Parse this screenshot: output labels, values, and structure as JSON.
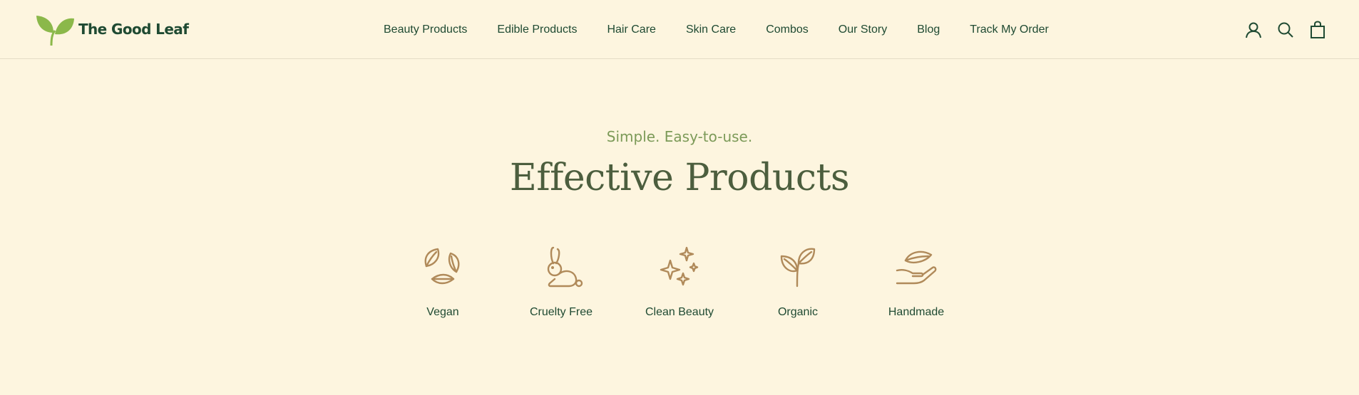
{
  "brand": {
    "name": "The Good Leaf"
  },
  "nav": {
    "items": [
      {
        "label": "Beauty Products"
      },
      {
        "label": "Edible Products"
      },
      {
        "label": "Hair Care"
      },
      {
        "label": "Skin Care"
      },
      {
        "label": "Combos"
      },
      {
        "label": "Our Story"
      },
      {
        "label": "Blog"
      },
      {
        "label": "Track My Order"
      }
    ]
  },
  "header_icons": [
    "account-icon",
    "search-icon",
    "cart-icon"
  ],
  "hero": {
    "eyebrow": "Simple. Easy-to-use.",
    "title": "Effective Products"
  },
  "features": [
    {
      "label": "Vegan",
      "icon": "leaves-icon"
    },
    {
      "label": "Cruelty Free",
      "icon": "rabbit-icon"
    },
    {
      "label": "Clean Beauty",
      "icon": "sparkles-icon"
    },
    {
      "label": "Organic",
      "icon": "sprout-icon"
    },
    {
      "label": "Handmade",
      "icon": "hand-leaf-icon"
    }
  ],
  "colors": {
    "background": "#fdf5df",
    "text": "#1f4a32",
    "accent_green": "#7c9a58",
    "headline": "#4c5e3e",
    "icon_tan": "#b08a5a",
    "logo_leaf": "#8bb84a"
  }
}
